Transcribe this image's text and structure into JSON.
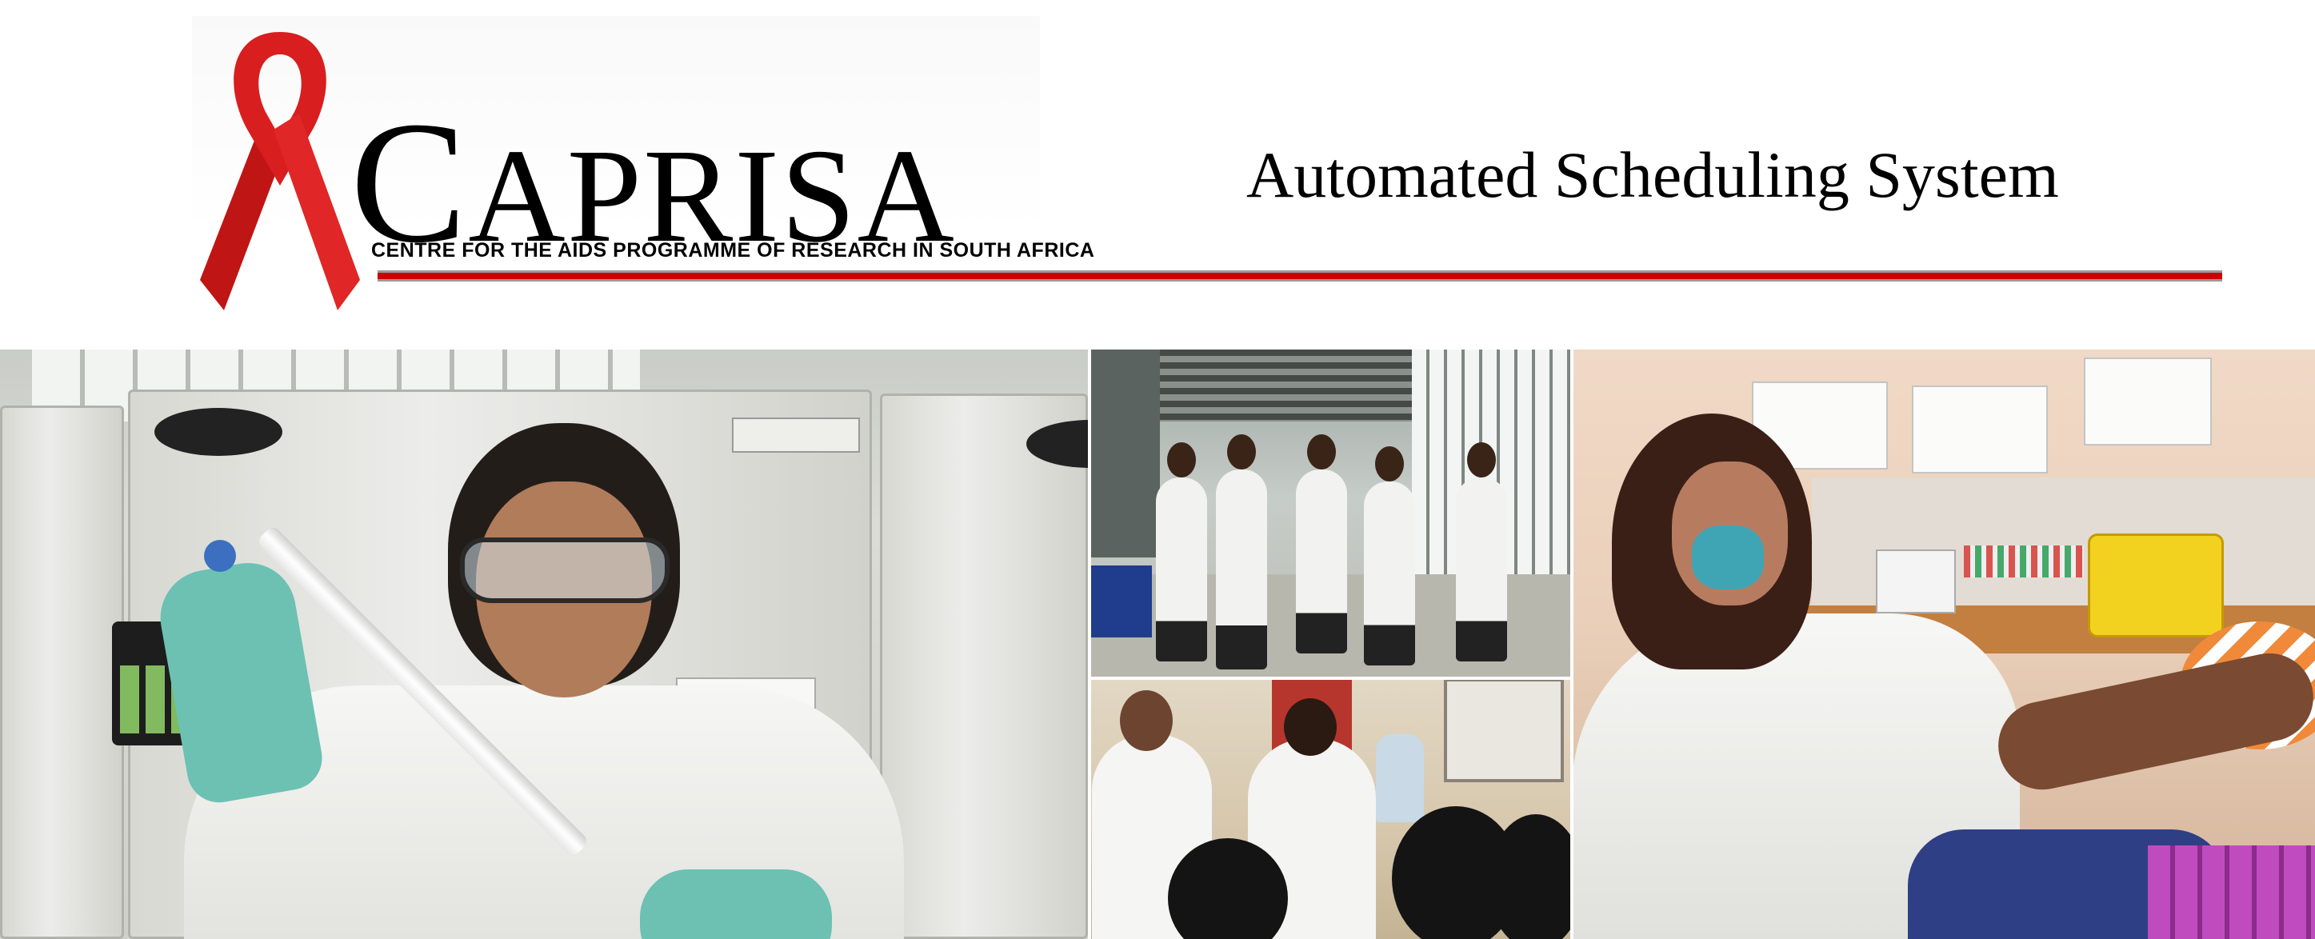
{
  "header": {
    "brand_initial": "C",
    "brand_rest": "APRISA",
    "brand_tagline": "CENTRE FOR THE AIDS PROGRAMME OF RESEARCH IN SOUTH AFRICA",
    "app_title": "Automated Scheduling System"
  },
  "colors": {
    "ribbon_red": "#d81e1e",
    "rule_red": "#cc0000",
    "text": "#000000",
    "background": "#ffffff"
  },
  "icons": {
    "logo": "red-awareness-ribbon-icon"
  },
  "collage": {
    "photos": [
      {
        "subject": "lab-researcher-with-pipette"
      },
      {
        "subject": "group-walking-in-corridor"
      },
      {
        "subject": "health-workers-with-community"
      },
      {
        "subject": "clinician-drawing-blood"
      }
    ]
  }
}
